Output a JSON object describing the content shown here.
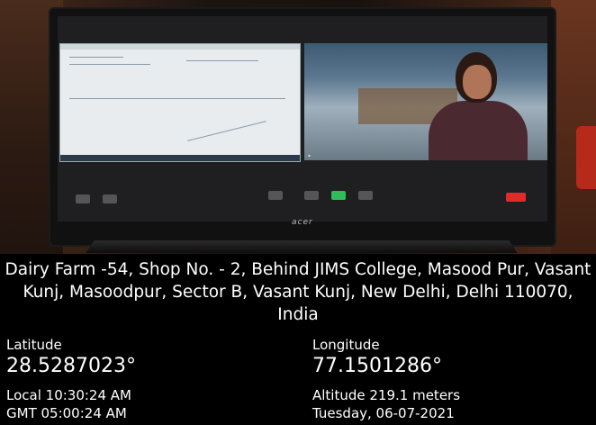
{
  "photo": {
    "monitor_brand": "acer"
  },
  "location": {
    "address": "Dairy Farm -54, Shop No. - 2, Behind JIMS College, Masood Pur, Vasant Kunj, Masoodpur, Sector B, Vasant Kunj, New Delhi, Delhi 110070, India"
  },
  "coordinates": {
    "latitude_label": "Latitude",
    "latitude_value": "28.5287023°",
    "longitude_label": "Longitude",
    "longitude_value": "77.1501286°"
  },
  "time": {
    "local": "Local 10:30:24 AM",
    "gmt": "GMT 05:00:24 AM"
  },
  "meta": {
    "altitude": "Altitude 219.1 meters",
    "date": "Tuesday, 06-07-2021"
  }
}
